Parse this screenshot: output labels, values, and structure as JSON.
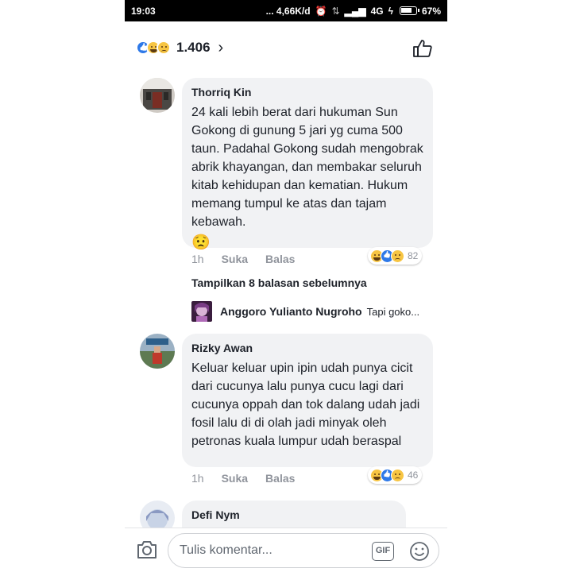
{
  "status_bar": {
    "time": "19:03",
    "network_speed": "... 4,66K/d",
    "network_type": "4G",
    "battery": "67%"
  },
  "header": {
    "reaction_count": "1.406",
    "reactions": [
      "like-icon",
      "haha-icon",
      "sad-icon"
    ]
  },
  "comments": [
    {
      "author": "Thorriq Kin",
      "text": "24 kali lebih berat dari hukuman Sun Gokong di gunung 5 jari yg cuma 500 taun. Padahal Gokong sudah mengobrak abrik khayangan, dan membakar seluruh kitab kehidupan dan kematian. Hukum memang tumpul ke atas dan tajam kebawah.",
      "emoji": "😟",
      "time": "1h",
      "like_label": "Suka",
      "reply_label": "Balas",
      "reaction_count": "82"
    },
    {
      "author": "Rizky Awan",
      "text": "Keluar keluar upin ipin udah punya cicit dari cucunya lalu punya cucu lagi dari cucunya oppah dan tok dalang udah jadi fosil lalu di di olah jadi minyak oleh petronas kuala lumpur udah beraspal",
      "time": "1h",
      "like_label": "Suka",
      "reply_label": "Balas",
      "reaction_count": "46"
    },
    {
      "author": "Defi Nym"
    }
  ],
  "replies": {
    "show_previous_label": "Tampilkan 8 balasan sebelumnya",
    "preview_author": "Anggoro Yulianto Nugroho",
    "preview_text": "Tapi goko..."
  },
  "composer": {
    "placeholder": "Tulis komentar...",
    "gif_label": "GIF"
  },
  "colors": {
    "bubble_bg": "#f1f2f4",
    "like_blue": "#2e79e8",
    "text_primary": "#1d2129",
    "text_secondary": "#90949c"
  }
}
